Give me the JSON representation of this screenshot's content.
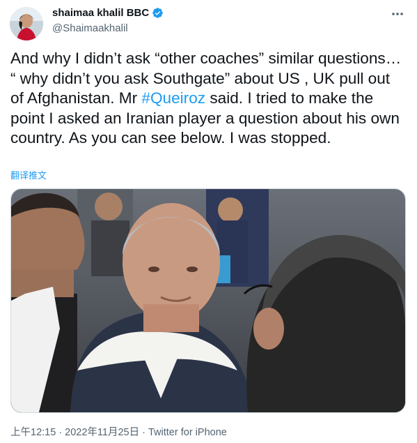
{
  "author": {
    "display_name": "shaimaa khalil BBC",
    "handle": "@Shaimaakhalil",
    "verified": true,
    "verified_color": "#1d9bf0",
    "avatar_icon": "profile-photo"
  },
  "tweet": {
    "text_before_hashtag": "And why I didn’t ask “other coaches” similar questions… “ why didn’t you ask Southgate” about US , UK pull out of Afghanistan. Mr ",
    "hashtag": "#Queiroz",
    "text_after_hashtag": " said. I tried to make the point I asked an Iranian player a question about his own country. As you can see below. I was stopped.",
    "translate_label": "翻译推文",
    "media_icon": "video-still-photo",
    "timestamp": "上午12:15 · 2022年11月25日 · Twitter for iPhone"
  },
  "colors": {
    "link": "#1d9bf0",
    "text": "#0f1419",
    "secondary": "#536471"
  },
  "icons": {
    "more": "more-horizontal-icon",
    "verified": "verified-badge-icon"
  }
}
